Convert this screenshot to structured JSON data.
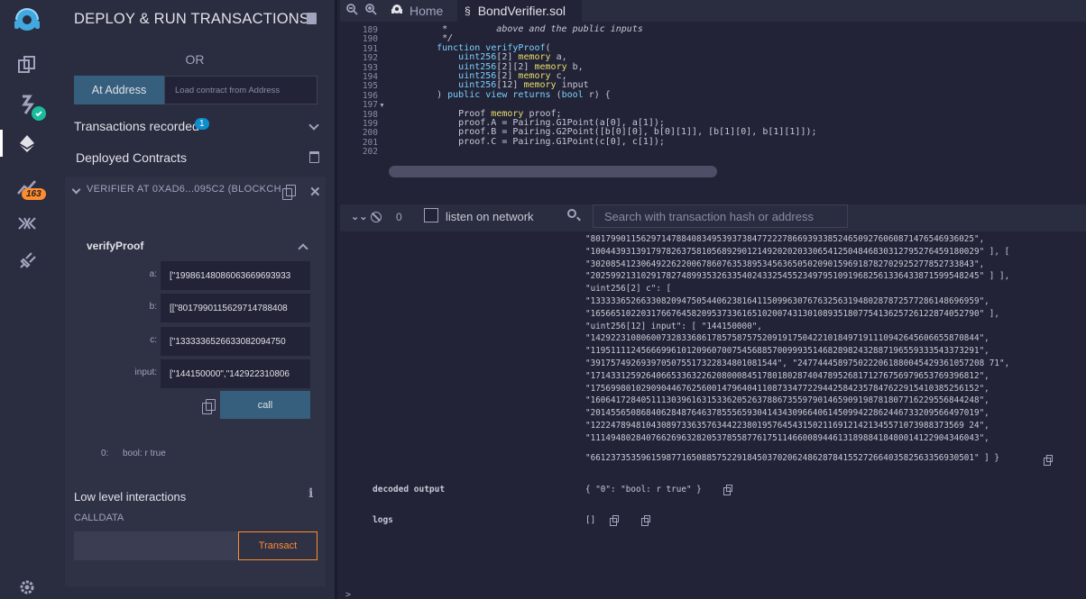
{
  "panel": {
    "title": "DEPLOY & RUN TRANSACTIONS",
    "or_label": "OR",
    "at_address_button": "At Address",
    "at_address_placeholder": "Load contract from Address",
    "transactions_recorded": "Transactions recorded",
    "transactions_count": "1",
    "deployed_contracts": "Deployed Contracts",
    "instance": {
      "header": "VERIFIER AT 0XAD6...095C2 (BLOCKCH",
      "function_name": "verifyProof",
      "params": [
        {
          "label": "a:",
          "value": "[\"19986148086063669693933"
        },
        {
          "label": "b:",
          "value": "[[\"8017990115629714788408"
        },
        {
          "label": "c:",
          "value": "[\"1333336526633082094750"
        },
        {
          "label": "input:",
          "value": "[\"144150000\",\"142922310806"
        }
      ],
      "call_button": "call",
      "result_index": "0:",
      "result_value": "bool: r true"
    },
    "low_level": "Low level interactions",
    "calldata_label": "CALLDATA",
    "transact_button": "Transact"
  },
  "rail": {
    "icons": [
      "remix-logo-icon",
      "file-explorer-icon",
      "compiler-icon",
      "deploy-icon",
      "analysis-icon",
      "debugger-icon",
      "plugin-icon",
      "settings-icon"
    ],
    "analysis_badge": "163"
  },
  "tabs": {
    "home": "Home",
    "active": "BondVerifier.sol"
  },
  "editor": {
    "lines": [
      {
        "n": "189",
        "t": "     *         above and the public inputs"
      },
      {
        "n": "190",
        "t": "     */"
      },
      {
        "n": "191",
        "t": "    function verifyProof("
      },
      {
        "n": "192",
        "t": "        uint256[2] memory a,"
      },
      {
        "n": "193",
        "t": "        uint256[2][2] memory b,"
      },
      {
        "n": "194",
        "t": "        uint256[2] memory c,"
      },
      {
        "n": "195",
        "t": "        uint256[12] memory input"
      },
      {
        "n": "196",
        "t": "    ) public view returns (bool r) {"
      },
      {
        "n": "197",
        "t": ""
      },
      {
        "n": "198",
        "t": "        Proof memory proof;"
      },
      {
        "n": "199",
        "t": "        proof.A = Pairing.G1Point(a[0], a[1]);"
      },
      {
        "n": "200",
        "t": "        proof.B = Pairing.G2Point([b[0][0], b[0][1]], [b[1][0], b[1][1]]);"
      },
      {
        "n": "201",
        "t": "        proof.C = Pairing.G1Point(c[0], c[1]);"
      },
      {
        "n": "202",
        "t": ""
      }
    ]
  },
  "terminal": {
    "count": "0",
    "listen_label": "listen on network",
    "search_placeholder": "Search with transaction hash or address",
    "output_lines": [
      "\"8017990115629714788408349539373847722278669393385246509276060871476546936025\",",
      "\"10044393139179782637581056892901214920202033065412504846830312795276459180029\" ], [",
      "\"3020854123064922622006786076353895345636505020901596918782702925277852733843\",",
      "\"20259921310291782748993532633540243325455234979510919682561336433871599548245\" ] ],",
      "\"uint256[2] c\": [",
      "\"13333365266330820947505440623816411509963076763256319480287872577286148696959\",",
      "\"16566510220317667645820953733616510200743130108935180775413625726122874052790\" ],",
      "\"uint256[12] input\": [ \"144150000\",",
      "\"14292231080600732833686178575875752091917504221018497191110942645606655870844\",",
      "\"11951111245666996101209607007545688570099935146828982432887196559333543373291\",",
      "\"3917574926939705075517322834801081544\", \"2477444589750222061880045429361057208 71\",",
      "\"17143312592640665336322620800084517801802874047895268171276756979653769396812\",",
      "\"17569980102909044676256001479640411087334772294425842357847622915410385256152\",",
      "\"16064172840511130396163153362052637886735597901465909198781807716229556844248\",",
      "\"20145565086840628487646378555659304143430966406145099422862446733209566497019\",",
      "\"12224789481043089733635763442238019576454315021169121421345571073988373569 24\",",
      "\"11149480284076626963282053785587761751146600894461318988418480014122904346043\","
    ],
    "output_last": "\"6612373535961598771650885752291845037020624862878415527266403582563356930501\" ] }",
    "decoded_label": "decoded output",
    "decoded_value": "{ \"0\": \"bool: r true\" }",
    "logs_label": "logs",
    "logs_value": "[]"
  }
}
